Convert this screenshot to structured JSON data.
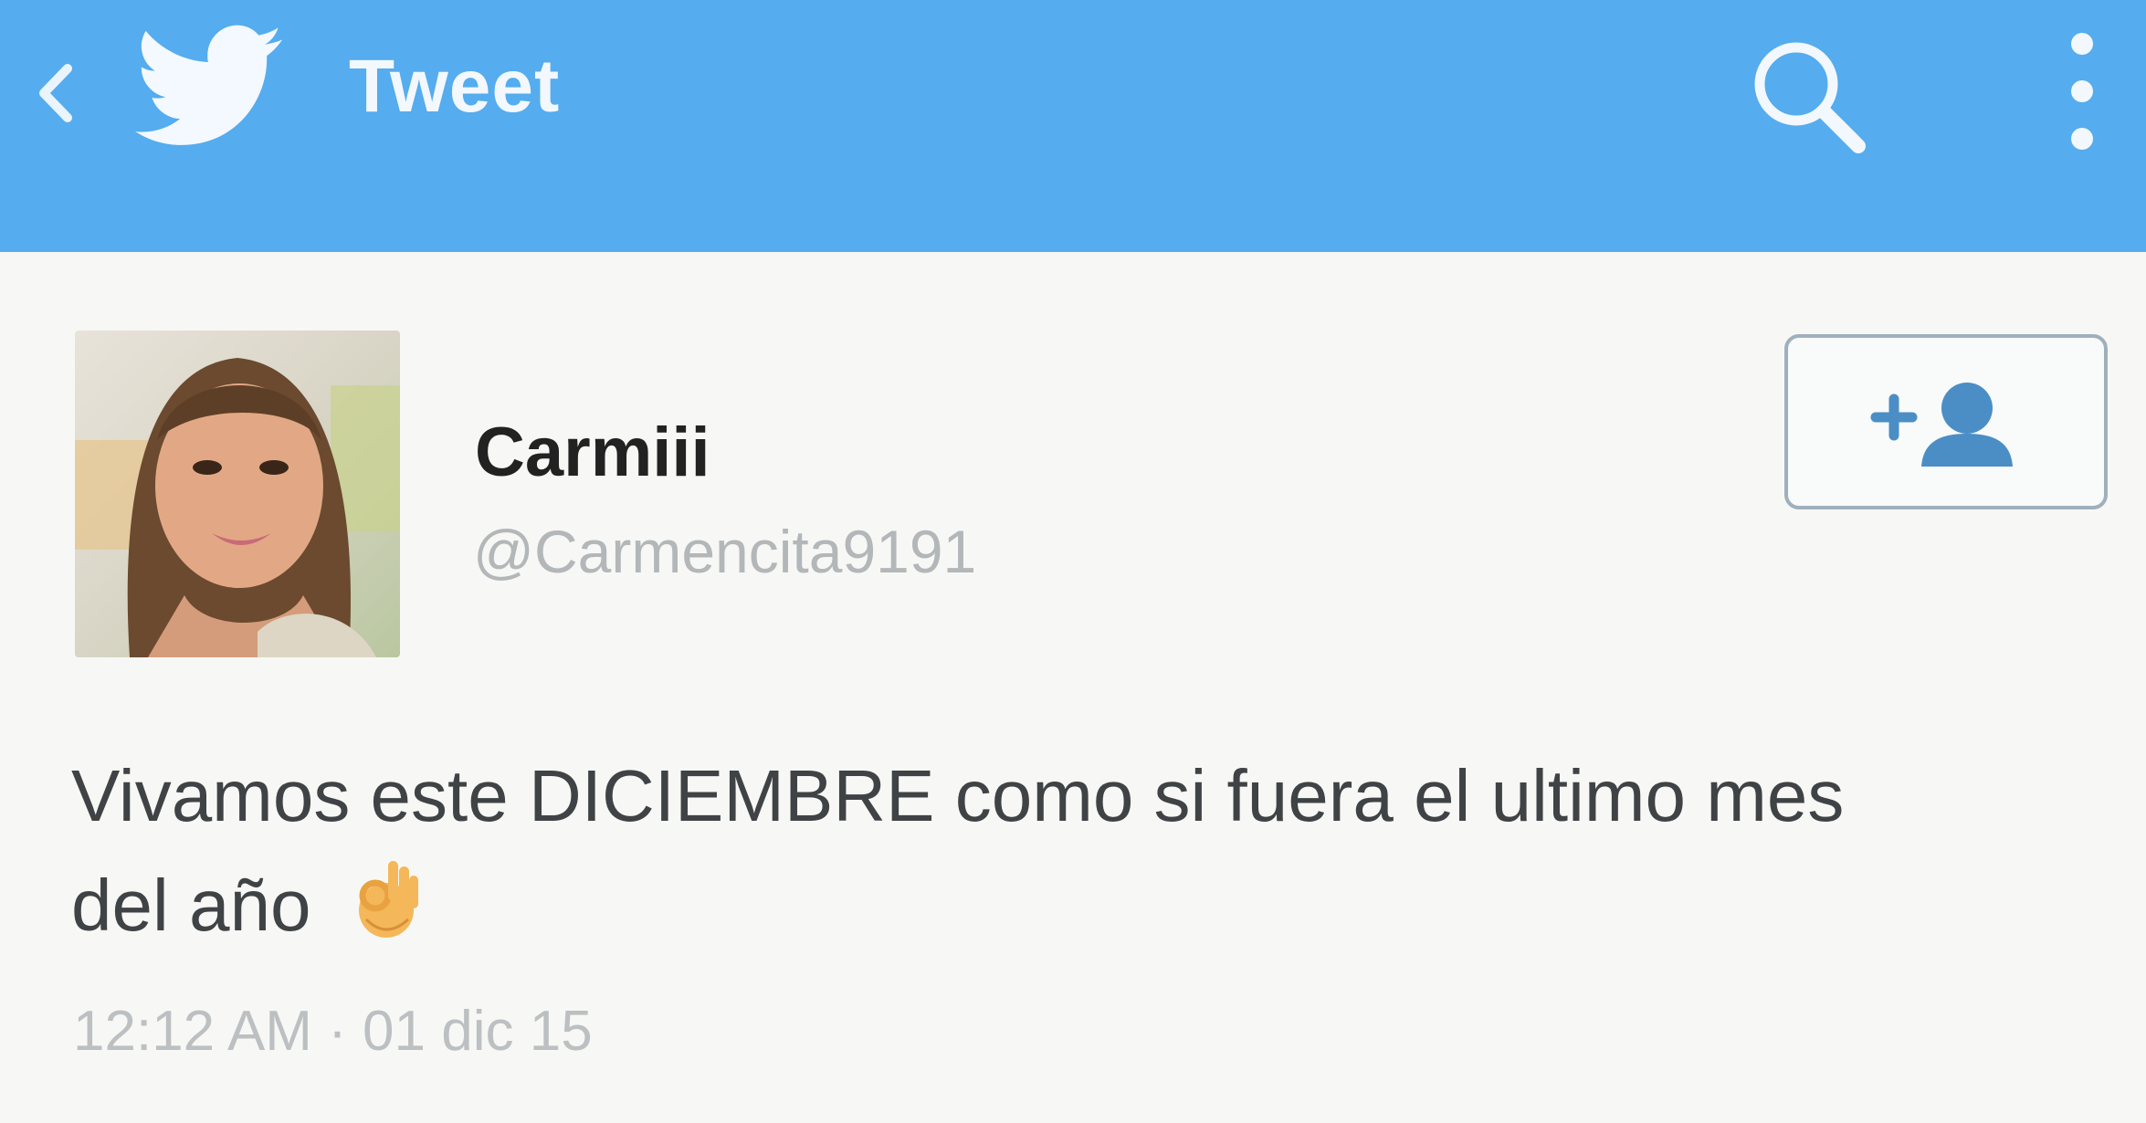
{
  "header": {
    "title": "Tweet",
    "back_icon": "chevron-left-icon",
    "logo_icon": "twitter-bird-icon",
    "search_icon": "search-icon",
    "menu_icon": "more-vertical-icon",
    "bar_color": "#55acee"
  },
  "tweet": {
    "author_name": "Carmiii",
    "author_handle": "@Carmencita9191",
    "text_line1": "Vivamos este DICIEMBRE como si fuera el ultimo mes",
    "text_line2": "del año",
    "emoji": "ok-hand-emoji",
    "timestamp": "12:12 AM · 01 dic 15",
    "follow_icon": "add-user-icon"
  }
}
